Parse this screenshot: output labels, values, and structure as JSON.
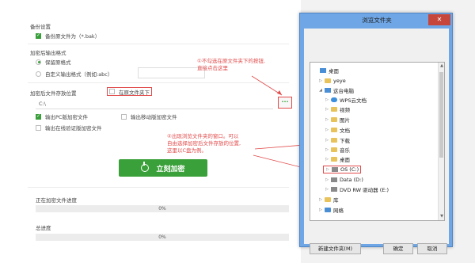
{
  "settings": {
    "backup_section": "备份设置",
    "backup_original": "备份原文件为（*.bak）",
    "output_format_section": "加密后输出格式",
    "keep_format": "保留原格式",
    "custom_format": "自定义输出格式（例如:abc）",
    "save_location_section": "加密后文件存放位置",
    "in_original_folder": "在原文件夹下",
    "path_value": "C:\\",
    "browse_button": "···",
    "output_pc": "输出PC版加密文件",
    "output_mobile": "输出移动版加密文件",
    "output_online": "输出在线验证版加密文件",
    "encrypt_button": "立刻加密"
  },
  "progress": {
    "current_label": "正在加密文件进度",
    "current_value": "0%",
    "total_label": "总进度",
    "total_value": "0%"
  },
  "annotations": {
    "note1_line1": "①不勾选在原文件夹下的按钮,",
    "note1_line2": "直接点击这里",
    "note2_line1": "②出现浏览文件夹的窗口。可以",
    "note2_line2": "自由选择加密后文件存放的位置,",
    "note2_line3": "这里以C盘为例。"
  },
  "dialog": {
    "title": "浏览文件夹",
    "close": "✕",
    "tree": [
      {
        "label": "桌面",
        "icon": "desktop-icon"
      },
      {
        "label": "yeye",
        "icon": "user-folder-icon"
      },
      {
        "label": "这台电脑",
        "icon": "pc-icon"
      },
      {
        "label": "WPS云文档",
        "icon": "cloud-icon"
      },
      {
        "label": "视频",
        "icon": "folder-icon"
      },
      {
        "label": "图片",
        "icon": "folder-icon"
      },
      {
        "label": "文档",
        "icon": "folder-icon"
      },
      {
        "label": "下载",
        "icon": "folder-icon"
      },
      {
        "label": "音乐",
        "icon": "folder-icon"
      },
      {
        "label": "桌面",
        "icon": "folder-icon"
      },
      {
        "label": "OS (C:)",
        "icon": "drive-icon"
      },
      {
        "label": "Data (D:)",
        "icon": "drive-icon"
      },
      {
        "label": "DVD RW 驱动器 (E:)",
        "icon": "dvd-icon"
      },
      {
        "label": "库",
        "icon": "library-icon"
      },
      {
        "label": "网络",
        "icon": "network-icon"
      }
    ],
    "new_folder_button": "新建文件夹(M)",
    "ok_button": "确定",
    "cancel_button": "取消"
  },
  "colors": {
    "accent_green": "#3aa03a",
    "annotation_red": "#e24a4a",
    "dialog_frame": "#6ea6e6"
  }
}
